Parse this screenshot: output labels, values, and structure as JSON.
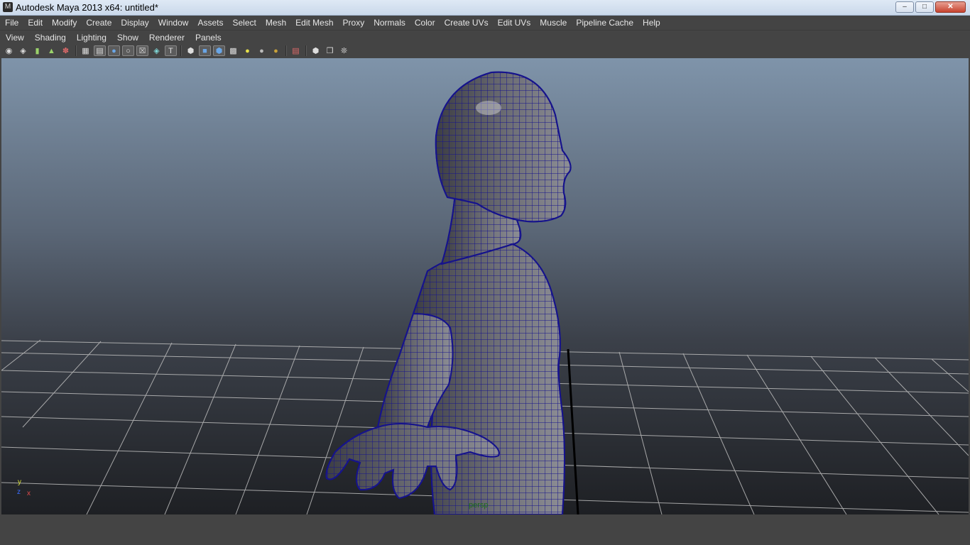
{
  "window": {
    "title": "Autodesk Maya 2013 x64: untitled*"
  },
  "menubar": [
    "File",
    "Edit",
    "Modify",
    "Create",
    "Display",
    "Window",
    "Assets",
    "Select",
    "Mesh",
    "Edit Mesh",
    "Proxy",
    "Normals",
    "Color",
    "Create UVs",
    "Edit UVs",
    "Muscle",
    "Pipeline Cache",
    "Help"
  ],
  "panel_menu": [
    "View",
    "Shading",
    "Lighting",
    "Show",
    "Renderer",
    "Panels"
  ],
  "viewport": {
    "camera": "persp",
    "axis": {
      "x": "x",
      "y": "y",
      "z": "z"
    }
  },
  "icons": {
    "toolbar": [
      "camera-select-icon",
      "camera-attributes-icon",
      "bookmark-icon",
      "image-plane-icon",
      "two-d-pan-zoom-icon",
      "grid-icon",
      "film-gate-icon",
      "resolution-gate-icon",
      "gate-mask-icon",
      "field-chart-icon",
      "safe-action-icon",
      "safe-title-icon",
      "wireframe-icon",
      "smooth-shade-icon",
      "wireframe-on-shaded-icon",
      "textured-icon",
      "use-default-lights-icon",
      "shadows-icon",
      "ambient-occlusion-icon",
      "isolate-select-icon",
      "xray-icon",
      "xray-joints-icon",
      "high-quality-icon"
    ]
  },
  "colors": {
    "accent_mesh_wire": "#16138c",
    "axis_y": "#d7e03a",
    "axis_x": "#e04a4a",
    "axis_z": "#3a6dff"
  }
}
